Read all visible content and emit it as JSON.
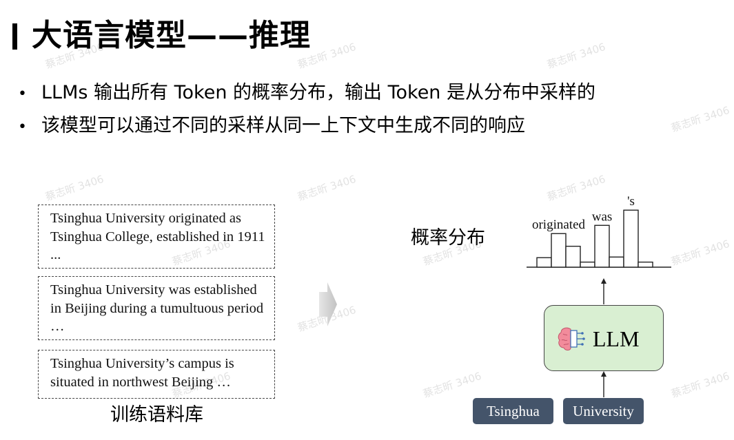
{
  "title": "大语言模型——推理",
  "bullets": [
    "LLMs 输出所有 Token 的概率分布，输出 Token 是从分布中采样的",
    "该模型可以通过不同的采样从同一上下文中生成不同的响应"
  ],
  "corpus": {
    "boxes": [
      {
        "text": "Tsinghua University originated as Tsinghua College, established in 1911 ..."
      },
      {
        "text": "Tsinghua University was established in Beijing during a tumultuous period …"
      },
      {
        "text": "Tsinghua University’s campus is situated in northwest Beijing …"
      }
    ],
    "label": "训练语料库"
  },
  "distribution": {
    "label": "概率分布",
    "bar_values": [
      0.15,
      0.53,
      0.33,
      0.08,
      0.66,
      0.16,
      0.9,
      0.08
    ],
    "word_labels": [
      {
        "text": "originated",
        "bar_index": 1
      },
      {
        "text": "was",
        "bar_index": 4
      },
      {
        "text": "'s",
        "bar_index": 6
      }
    ]
  },
  "model": {
    "label": "LLM",
    "icon": "brain-circuit-icon",
    "fill_color": "#d9efd2"
  },
  "tokens": [
    {
      "text": "Tsinghua"
    },
    {
      "text": "University"
    }
  ],
  "token_color": "#44546a",
  "watermark_text": "蔡志昕 3406"
}
